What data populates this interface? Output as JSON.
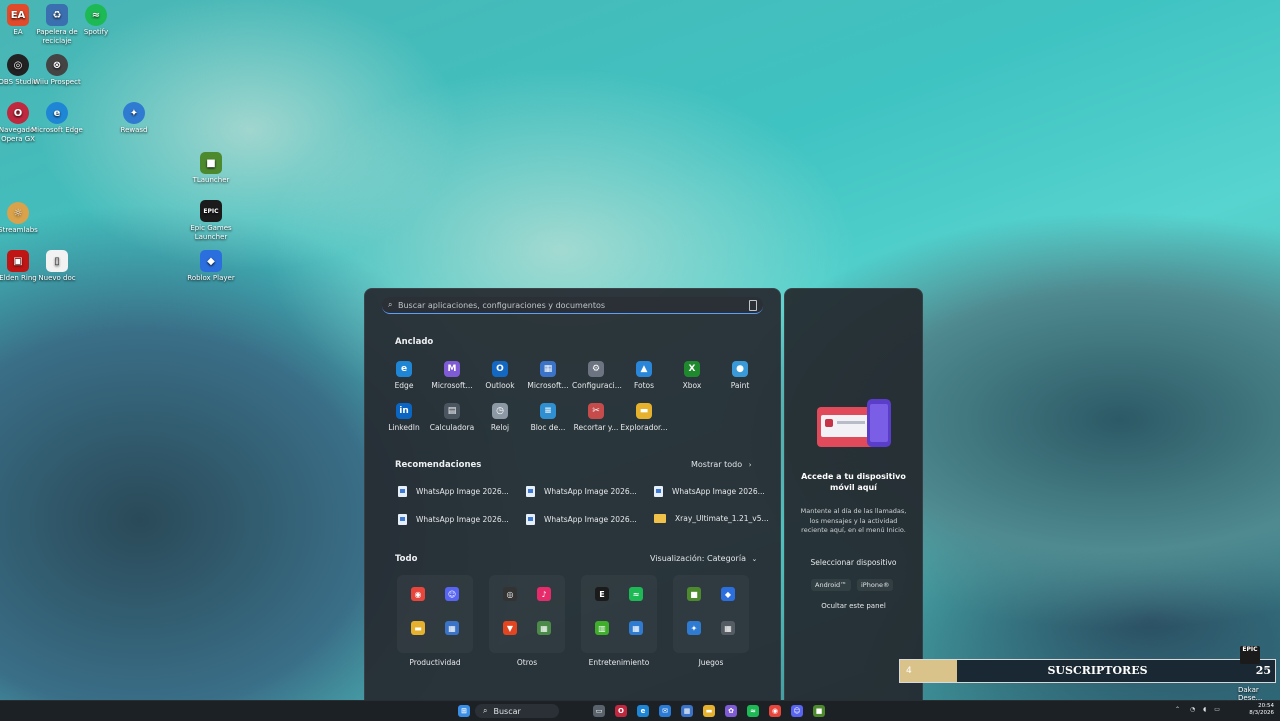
{
  "desktop": {
    "icons": [
      {
        "label": "EA",
        "icon": "ea-icon",
        "color": "#e14a2a"
      },
      {
        "label": "Papelera de reciclaje",
        "icon": "recycle-bin-icon",
        "color": "#3a6fb0"
      },
      {
        "label": "Spotify",
        "icon": "spotify-icon",
        "color": "#1db954"
      },
      {
        "label": "OBS Studio",
        "icon": "obs-icon",
        "color": "#222222"
      },
      {
        "label": "Wiiu Prospect",
        "icon": "app-icon",
        "color": "#444444"
      },
      {
        "label": "Navegador Opera GX",
        "icon": "opera-gx-icon",
        "color": "#c0283f"
      },
      {
        "label": "Microsoft Edge",
        "icon": "edge-icon",
        "color": "#1f86d6"
      },
      {
        "label": "Rewasd",
        "icon": "gamepad-icon",
        "color": "#2f7bd2"
      },
      {
        "label": "TLauncher",
        "icon": "minecraft-icon",
        "color": "#4d8a2e"
      },
      {
        "label": "Streamlabs",
        "icon": "streamlabs-icon",
        "color": "#d9a24b"
      },
      {
        "label": "Epic Games Launcher",
        "icon": "epic-games-icon",
        "color": "#1b1b1b"
      },
      {
        "label": "Roblox Player",
        "icon": "roblox-icon",
        "color": "#2b6fde"
      },
      {
        "label": "Elden Ring",
        "icon": "game-icon",
        "color": "#c01515"
      },
      {
        "label": "Nuevo doc",
        "icon": "document-icon",
        "color": "#f2f2f2"
      }
    ]
  },
  "start_menu": {
    "search_placeholder": "Buscar aplicaciones, configuraciones y documentos",
    "pinned_title": "Anclado",
    "pinned": [
      {
        "label": "Edge",
        "icon": "edge-icon",
        "color": "#1f86d6",
        "glyph": "e"
      },
      {
        "label": "Microsoft...",
        "icon": "microsoft-365-icon",
        "color": "#7f5bd6",
        "glyph": "M"
      },
      {
        "label": "Outlook",
        "icon": "outlook-icon",
        "color": "#1368c4",
        "glyph": "O"
      },
      {
        "label": "Microsoft...",
        "icon": "microsoft-store-icon",
        "color": "#3a73c8",
        "glyph": "▦"
      },
      {
        "label": "Configuraci...",
        "icon": "settings-gear-icon",
        "color": "#6b7480",
        "glyph": "⚙"
      },
      {
        "label": "Fotos",
        "icon": "photos-icon",
        "color": "#2a86d8",
        "glyph": "▲"
      },
      {
        "label": "Xbox",
        "icon": "xbox-icon",
        "color": "#1f8a2d",
        "glyph": "X"
      },
      {
        "label": "Paint",
        "icon": "paint-icon",
        "color": "#3a9ad9",
        "glyph": "●"
      },
      {
        "label": "LinkedIn",
        "icon": "linkedin-icon",
        "color": "#0a66c2",
        "glyph": "in"
      },
      {
        "label": "Calculadora",
        "icon": "calculator-icon",
        "color": "#4b5560",
        "glyph": "▤"
      },
      {
        "label": "Reloj",
        "icon": "clock-icon",
        "color": "#8c98a4",
        "glyph": "◷"
      },
      {
        "label": "Bloc de...",
        "icon": "notepad-icon",
        "color": "#2f8fd0",
        "glyph": "≡"
      },
      {
        "label": "Recortar y...",
        "icon": "snipping-tool-icon",
        "color": "#c64b4b",
        "glyph": "✂"
      },
      {
        "label": "Explorador...",
        "icon": "file-explorer-icon",
        "color": "#e6b12c",
        "glyph": "▬"
      }
    ],
    "recommended_title": "Recomendaciones",
    "show_all": "Mostrar todo",
    "recommended": [
      {
        "label": "WhatsApp Image 2026...",
        "kind": "image"
      },
      {
        "label": "WhatsApp Image 2026...",
        "kind": "image"
      },
      {
        "label": "WhatsApp Image 2026...",
        "kind": "image"
      },
      {
        "label": "WhatsApp Image 2026...",
        "kind": "image"
      },
      {
        "label": "WhatsApp Image 2026...",
        "kind": "image"
      },
      {
        "label": "Xray_Ultimate_1.21_v5...",
        "kind": "folder"
      }
    ],
    "all_title": "Todo",
    "view_label": "Visualización: Categoría",
    "categories": [
      {
        "label": "Productividad",
        "apps": [
          {
            "icon": "chrome-icon",
            "color": "#e8453c",
            "glyph": "◉"
          },
          {
            "icon": "discord-icon",
            "color": "#5865f2",
            "glyph": "☺"
          },
          {
            "icon": "file-explorer-icon",
            "color": "#e6b12c",
            "glyph": "▬"
          },
          {
            "icon": "app-group-icon",
            "color": "#3a73c8",
            "glyph": "▦"
          }
        ]
      },
      {
        "label": "Otros",
        "apps": [
          {
            "icon": "obs-icon",
            "color": "#333333",
            "glyph": "◎"
          },
          {
            "icon": "tiktok-icon",
            "color": "#e62a6a",
            "glyph": "♪"
          },
          {
            "icon": "brave-icon",
            "color": "#e2451f",
            "glyph": "▼"
          },
          {
            "icon": "app-group-icon",
            "color": "#4b8a48",
            "glyph": "▦"
          }
        ]
      },
      {
        "label": "Entretenimiento",
        "apps": [
          {
            "icon": "epic-games-icon",
            "color": "#1b1b1b",
            "glyph": "E"
          },
          {
            "icon": "spotify-icon",
            "color": "#1db954",
            "glyph": "≈"
          },
          {
            "icon": "xbox-game-bar-icon",
            "color": "#3fae2a",
            "glyph": "▥"
          },
          {
            "icon": "app-group-icon",
            "color": "#2f7bd2",
            "glyph": "▦"
          }
        ]
      },
      {
        "label": "Juegos",
        "apps": [
          {
            "icon": "minecraft-icon",
            "color": "#4d8a2e",
            "glyph": "■"
          },
          {
            "icon": "roblox-icon",
            "color": "#2b6fde",
            "glyph": "◆"
          },
          {
            "icon": "gamepad-icon",
            "color": "#2f7bd2",
            "glyph": "✦"
          },
          {
            "icon": "app-group-icon",
            "color": "#555c63",
            "glyph": "▦"
          }
        ]
      }
    ]
  },
  "phone_panel": {
    "title": "Accede a tu dispositivo móvil aquí",
    "description": "Mantente al día de las llamadas, los mensajes y la actividad reciente aquí, en el menú Inicio.",
    "select_label": "Seleccionar dispositivo",
    "options": [
      "Android™",
      "iPhone®"
    ],
    "hide_label": "Ocultar este panel"
  },
  "overlay": {
    "number": "4",
    "label": "SUSCRIPTORES",
    "count": "25",
    "epic": "EPIC",
    "side_text": "Dakar Dese..."
  },
  "taskbar": {
    "search_label": "Buscar",
    "time": "20:54",
    "date": "8/3/2026",
    "apps": [
      {
        "icon": "windows-start-icon",
        "color": "#3a8ee6",
        "glyph": "⊞"
      },
      {
        "icon": "task-view-icon",
        "color": "#5a626b",
        "glyph": "▭"
      },
      {
        "icon": "opera-gx-icon",
        "color": "#c0283f",
        "glyph": "O"
      },
      {
        "icon": "edge-icon",
        "color": "#1f86d6",
        "glyph": "e"
      },
      {
        "icon": "mail-icon",
        "color": "#2a7bd6",
        "glyph": "✉"
      },
      {
        "icon": "microsoft-store-icon",
        "color": "#3a73c8",
        "glyph": "▦"
      },
      {
        "icon": "file-explorer-icon",
        "color": "#e6b12c",
        "glyph": "▬"
      },
      {
        "icon": "copilot-icon",
        "color": "#7f5bd6",
        "glyph": "✿"
      },
      {
        "icon": "spotify-icon",
        "color": "#1db954",
        "glyph": "≈"
      },
      {
        "icon": "chrome-icon",
        "color": "#e8453c",
        "glyph": "◉"
      },
      {
        "icon": "discord-icon",
        "color": "#5865f2",
        "glyph": "☺"
      },
      {
        "icon": "minecraft-icon",
        "color": "#4d8a2e",
        "glyph": "■"
      }
    ]
  }
}
